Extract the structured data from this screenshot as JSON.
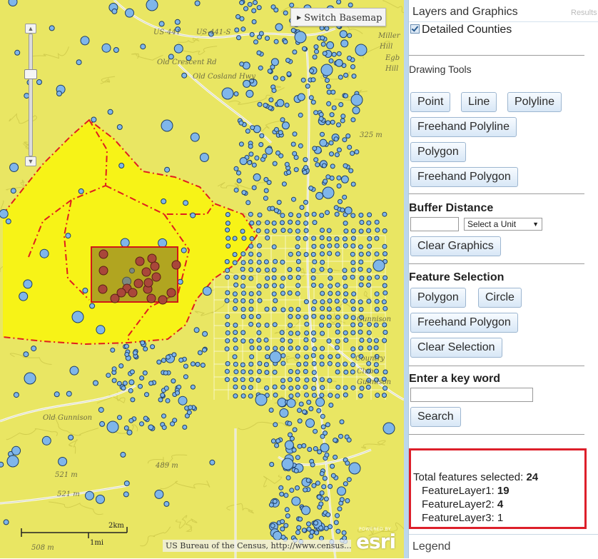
{
  "map": {
    "switch_basemap_label": "Switch Basemap",
    "attribution": "US Bureau of the Census, http://www.census....",
    "esri_powered": "POWERED BY",
    "esri_word": "esri",
    "scale_km": "2km",
    "scale_mi": "1mi",
    "labels": [
      {
        "text": "US-441"
      },
      {
        "text": "US-441-S"
      },
      {
        "text": "Miller"
      },
      {
        "text": "Hill"
      },
      {
        "text": "Egb"
      },
      {
        "text": "Hill"
      },
      {
        "text": "Old Cosland Hwy"
      },
      {
        "text": "Old Crescent Rd"
      },
      {
        "text": "325 m"
      },
      {
        "text": "508 m"
      },
      {
        "text": "521 m"
      },
      {
        "text": "521 m"
      },
      {
        "text": "489 m"
      },
      {
        "text": "Old Gunnison"
      },
      {
        "text": "Gunnison"
      },
      {
        "text": "Country"
      },
      {
        "text": "Club"
      },
      {
        "text": "Gunnison"
      }
    ],
    "colors": {
      "map_bg": "#e9e663",
      "county_fill": "#f7f317",
      "boundary": "#e01e1e",
      "dot": "#7fb6ea",
      "selected_dot": "#a9473a"
    }
  },
  "panel": {
    "header_title": "Layers and Graphics",
    "results_tab": "Results",
    "layer_checkbox_label": "Detailed Counties",
    "drawing_tools_label": "Drawing Tools",
    "drawing_buttons": [
      "Point",
      "Line",
      "Polyline",
      "Freehand Polyline",
      "Polygon",
      "Freehand Polygon"
    ],
    "buffer_title": "Buffer Distance",
    "unit_select_value": "Select a Unit",
    "clear_graphics_label": "Clear Graphics",
    "feature_selection_title": "Feature Selection",
    "selection_buttons": [
      "Polygon",
      "Circle",
      "Freehand Polygon",
      "Clear Selection"
    ],
    "keyword_title": "Enter a key word",
    "search_label": "Search",
    "results": {
      "total_label": "Total features selected:",
      "total_value": "24",
      "layers": [
        {
          "name": "FeatureLayer1:",
          "value": "19",
          "bold": true
        },
        {
          "name": "FeatureLayer2:",
          "value": "4",
          "bold": true
        },
        {
          "name": "FeatureLayer3:",
          "value": "1",
          "bold": false
        }
      ]
    },
    "legend_label": "Legend"
  }
}
